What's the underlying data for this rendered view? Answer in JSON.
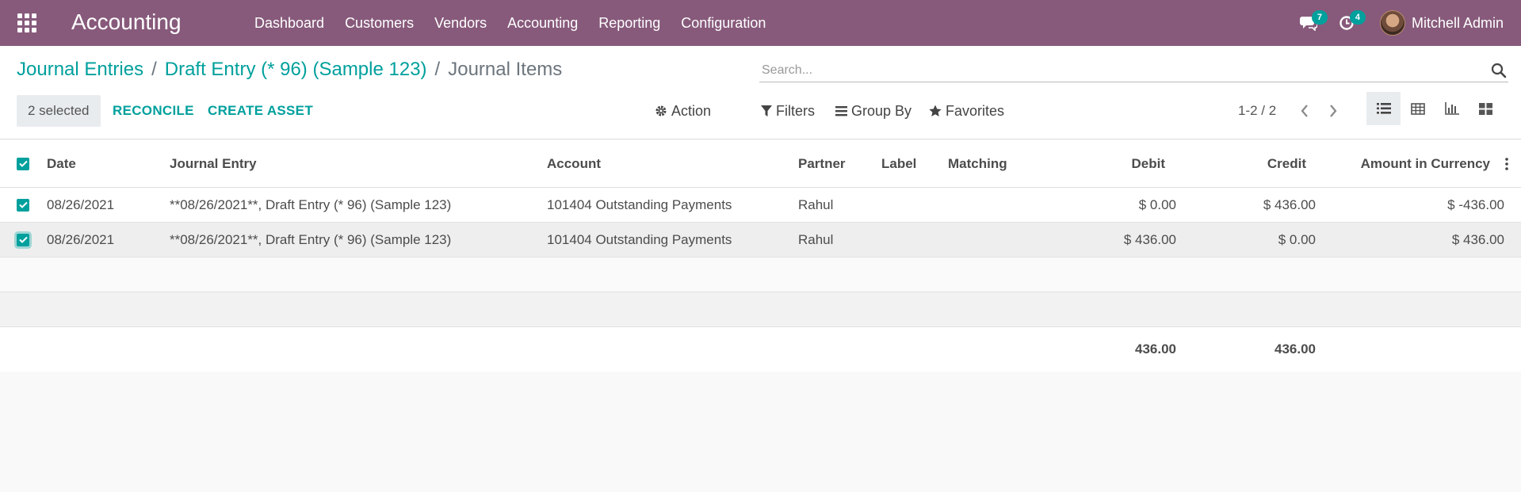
{
  "navbar": {
    "app_title": "Accounting",
    "menu": [
      "Dashboard",
      "Customers",
      "Vendors",
      "Accounting",
      "Reporting",
      "Configuration"
    ],
    "messages_badge": "7",
    "activities_badge": "4",
    "user_name": "Mitchell Admin",
    "bg_color": "#875a7b"
  },
  "breadcrumb": {
    "items": [
      "Journal Entries",
      "Draft Entry (* 96) (Sample 123)"
    ],
    "separator": "/",
    "current": "Journal Items"
  },
  "search": {
    "placeholder": "Search..."
  },
  "toolbar": {
    "selected_label": "2 selected",
    "reconcile_label": "RECONCILE",
    "create_asset_label": "CREATE ASSET",
    "action_label": "Action",
    "filters_label": "Filters",
    "group_by_label": "Group By",
    "favorites_label": "Favorites",
    "pager": "1-2 / 2"
  },
  "table": {
    "columns": [
      "Date",
      "Journal Entry",
      "Account",
      "Partner",
      "Label",
      "Matching",
      "Debit",
      "Credit",
      "Amount in Currency"
    ],
    "rows": [
      {
        "date": "08/26/2021",
        "journal_entry": "**08/26/2021**, Draft Entry (* 96) (Sample 123)",
        "account": "101404 Outstanding Payments",
        "partner": "Rahul",
        "label": "",
        "matching": "",
        "debit": "$ 0.00",
        "credit": "$ 436.00",
        "amount_currency": "$ -436.00",
        "checked": true
      },
      {
        "date": "08/26/2021",
        "journal_entry": "**08/26/2021**, Draft Entry (* 96) (Sample 123)",
        "account": "101404 Outstanding Payments",
        "partner": "Rahul",
        "label": "",
        "matching": "",
        "debit": "$ 436.00",
        "credit": "$ 0.00",
        "amount_currency": "$ 436.00",
        "checked": true
      }
    ],
    "totals": {
      "debit": "436.00",
      "credit": "436.00"
    }
  },
  "colors": {
    "accent": "#00a09d",
    "brand": "#875a7b"
  }
}
